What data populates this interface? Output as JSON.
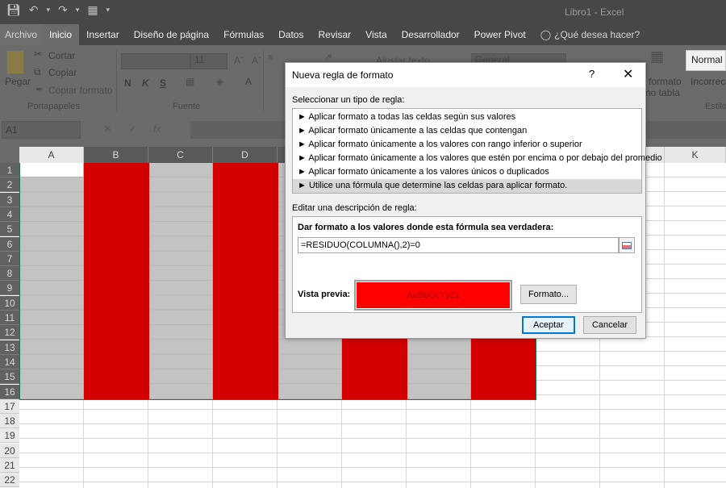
{
  "window": {
    "title": "Libro1 - Excel"
  },
  "qat": {
    "save_icon": "save-icon",
    "undo_icon": "undo-icon",
    "redo_icon": "redo-icon",
    "form_icon": "form-icon"
  },
  "tabs": [
    {
      "label": "Archivo"
    },
    {
      "label": "Inicio"
    },
    {
      "label": "Insertar"
    },
    {
      "label": "Diseño de página"
    },
    {
      "label": "Fórmulas"
    },
    {
      "label": "Datos"
    },
    {
      "label": "Revisar"
    },
    {
      "label": "Vista"
    },
    {
      "label": "Desarrollador"
    },
    {
      "label": "Power Pivot"
    }
  ],
  "tell_me": "¿Qué desea hacer?",
  "ribbon": {
    "paste": "Pegar",
    "cut": "Cortar",
    "copy": "Copiar",
    "copy_format": "Copiar formato",
    "clipboard_group": "Portapapeles",
    "font_size": "11",
    "bold": "N",
    "italic": "K",
    "underline": "S",
    "font_group": "Fuente",
    "wrap_text": "Ajustar texto",
    "number_format": "General",
    "format_as": "formato",
    "as_table": "como tabla",
    "styles_group": "Estilos",
    "style_normal": "Normal",
    "style_incorrect": "Incorrec"
  },
  "formula_bar": {
    "name_box": "A1",
    "fx": "fx"
  },
  "grid": {
    "columns": [
      "A",
      "B",
      "C",
      "D",
      "E",
      "F",
      "G",
      "H",
      "I",
      "J",
      "K"
    ],
    "rows": [
      "1",
      "2",
      "3",
      "4",
      "5",
      "6",
      "7",
      "8",
      "9",
      "10",
      "11",
      "12",
      "13",
      "14",
      "15",
      "16",
      "17",
      "18",
      "19",
      "20",
      "21",
      "22"
    ],
    "highlight_color": "#d20000"
  },
  "dialog": {
    "title": "Nueva regla de formato",
    "help": "?",
    "close": "✕",
    "select_type_label": "Seleccionar un tipo de regla:",
    "rule_types": [
      "► Aplicar formato a todas las celdas según sus valores",
      "► Aplicar formato únicamente a las celdas que contengan",
      "► Aplicar formato únicamente a los valores con rango inferior o superior",
      "► Aplicar formato únicamente a los valores que estén por encima o por debajo del promedio",
      "► Aplicar formato únicamente a los valores únicos o duplicados",
      "► Utilice una fórmula que determine las celdas para aplicar formato."
    ],
    "edit_desc_label": "Editar una descripción de regla:",
    "formula_label": "Dar formato a los valores donde esta fórmula sea verdadera:",
    "formula_value": "=RESIDUO(COLUMNA(),2)=0",
    "preview_label": "Vista previa:",
    "preview_text": "AaBbCcYyZz",
    "preview_color": "#ff0000",
    "format_button": "Formato...",
    "accept_button": "Aceptar",
    "cancel_button": "Cancelar"
  }
}
